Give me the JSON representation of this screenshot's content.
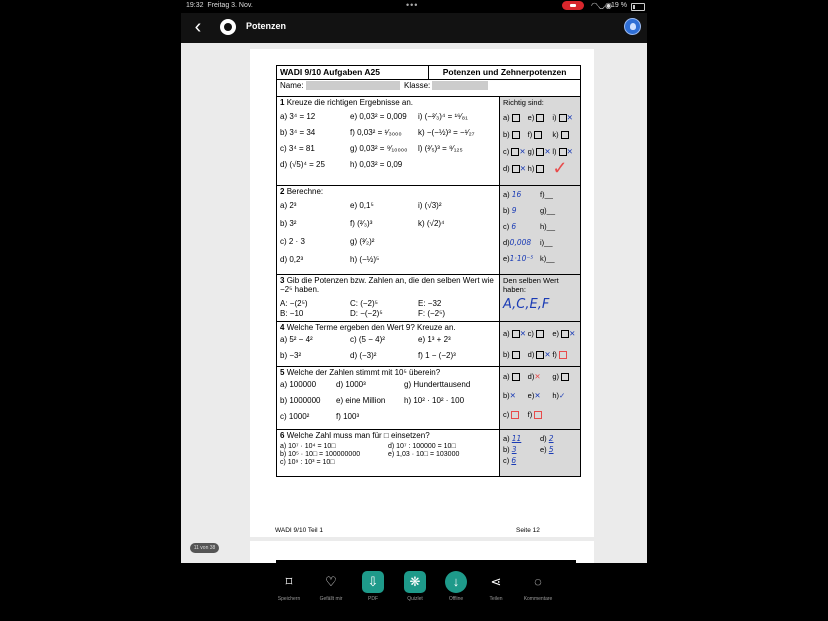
{
  "status_bar": {
    "time": "19:32",
    "date": "Freitag 3. Nov.",
    "battery": "19 %"
  },
  "nav": {
    "title": "Potenzen"
  },
  "worksheet": {
    "header_left": "WADI  9/10 Aufgaben A25",
    "header_right": "Potenzen und Zehnerpotenzen",
    "name_label": "Name:",
    "class_label": "Klasse:",
    "tasks": [
      {
        "number": "1",
        "text": "Kreuze die richtigen Ergebnisse an.",
        "answer_header": "Richtig sind:",
        "items": [
          "a) 3⁴ = 12",
          "e) 0,03² = 0,009",
          "i) (−²⁄₃)⁴ = ¹⁶⁄₈₁",
          "b) 3⁴ = 34",
          "f) 0,03² = ¹⁄₃₀₀₀",
          "k) −(−½)³ = −¹⁄₂₇",
          "c) 3⁴ = 81",
          "g) 0,03² = ⁹⁄₁₀₀₀₀",
          "l) (²⁄₅)³ = ⁸⁄₁₂₅",
          "d) (√5)⁴ = 25",
          "h) 0,03² = 0,09",
          ""
        ],
        "answers": [
          "a)",
          "e)",
          "i)",
          "b)",
          "f)",
          "k)",
          "c)",
          "g)",
          "l)",
          "d)",
          "h)",
          ""
        ]
      },
      {
        "number": "2",
        "text": "Berechne:",
        "items": [
          "a) 2³",
          "e) 0,1⁵",
          "i) (√3)²",
          "b) 3²",
          "f) (²⁄₃)³",
          "k) (√2)⁴",
          "c) 2 · 3",
          "g) (³⁄₂)²",
          "",
          "d) 0,2³",
          "h) (−½)⁵",
          ""
        ],
        "answers": [
          {
            "l": "a)",
            "v": "16"
          },
          {
            "l": "f)",
            "v": "__"
          },
          {
            "l": "b)",
            "v": "9"
          },
          {
            "l": "g)",
            "v": "__"
          },
          {
            "l": "c)",
            "v": "6"
          },
          {
            "l": "h)",
            "v": "__"
          },
          {
            "l": "d)",
            "v": "0,008"
          },
          {
            "l": "i)",
            "v": "__"
          },
          {
            "l": "e)",
            "v": "1·10⁻⁵"
          },
          {
            "l": "k)",
            "v": "__"
          }
        ]
      },
      {
        "number": "3",
        "text": "Gib die Potenzen bzw. Zahlen an, die den selben Wert wie −2⁵ haben.",
        "answer_header": "Den selben Wert haben:",
        "items": [
          "A: −(2⁵)",
          "C: (−2)⁵",
          "E: −32",
          "B: −10",
          "D: −(−2)⁵",
          "F: (−2⁵)"
        ],
        "handwritten": "A,C,E,F"
      },
      {
        "number": "4",
        "text": "Welche Terme ergeben den Wert 9? Kreuze an.",
        "items": [
          "a) 5² − 4²",
          "c) (5 − 4)²",
          "e) 1³ + 2³",
          "b) −3²",
          "d) (−3)²",
          "f) 1 − (−2)³"
        ],
        "answers": [
          "a)",
          "c)",
          "e)",
          "b)",
          "d)",
          "f)"
        ]
      },
      {
        "number": "5",
        "text": "Welche der Zahlen stimmt mit 10⁵ überein?",
        "items": [
          "a) 100000",
          "d) 1000³",
          "g) Hunderttausend",
          "b) 1000000",
          "e) eine Million",
          "h) 10² · 10² · 100",
          "c) 1000²",
          "f) 100³",
          ""
        ],
        "answers": [
          "a)",
          "d)",
          "g)",
          "b)",
          "e)",
          "h)",
          "c)",
          "f)",
          ""
        ]
      },
      {
        "number": "6",
        "text": "Welche Zahl muss man für □ einsetzen?",
        "items": [
          "a) 10⁷ · 10⁴ = 10□",
          "d) 10⁷ : 100000 = 10□",
          "b) 10⁵ · 10□ = 100000000",
          "e) 1,03 · 10□ = 103000",
          "c) 10⁹ : 10³ = 10□",
          ""
        ],
        "answers": [
          {
            "l": "a)",
            "v": "11"
          },
          {
            "l": "d)",
            "v": "2"
          },
          {
            "l": "b)",
            "v": "3"
          },
          {
            "l": "e)",
            "v": "5"
          },
          {
            "l": "c)",
            "v": "6"
          },
          {
            "l": "",
            "v": ""
          }
        ]
      }
    ],
    "footer_left": "WADI 9/10 Teil 1",
    "footer_right": "Seite 12"
  },
  "page_badge": "11 von 38",
  "toolbar": [
    {
      "label": "Speichern",
      "icon": "bookmark-icon"
    },
    {
      "label": "Gefällt mir",
      "icon": "heart-icon"
    },
    {
      "label": "PDF",
      "icon": "pdf-icon"
    },
    {
      "label": "Quizlet",
      "icon": "quizlet-icon"
    },
    {
      "label": "Offline",
      "icon": "download-icon"
    },
    {
      "label": "Teilen",
      "icon": "share-icon"
    },
    {
      "label": "Kommentare",
      "icon": "comment-icon"
    }
  ]
}
